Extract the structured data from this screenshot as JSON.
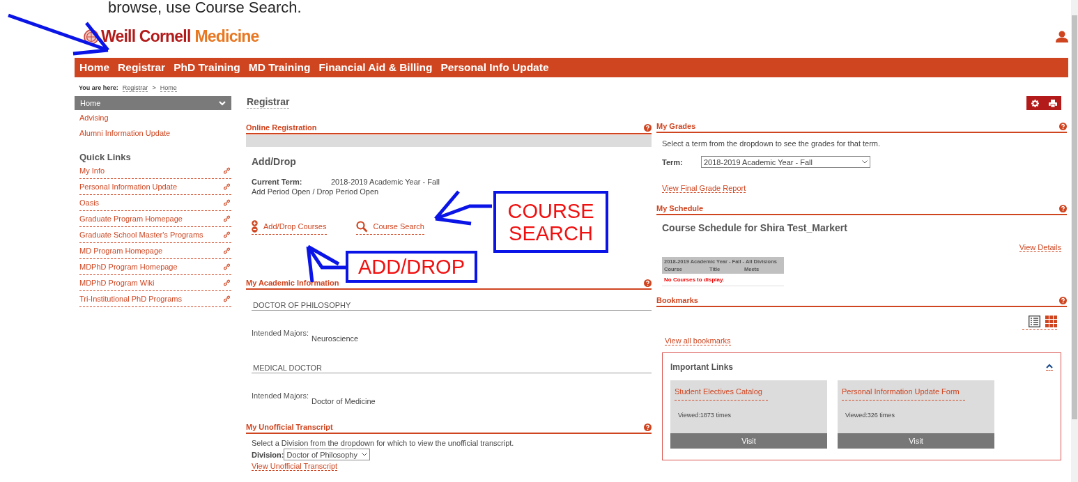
{
  "caption": "browse, use  Course Search.",
  "logo": {
    "primary": "Weill Cornell",
    "secondary": "Medicine"
  },
  "nav": [
    "Home",
    "Registrar",
    "PhD Training",
    "MD Training",
    "Financial Aid & Billing",
    "Personal Info Update"
  ],
  "breadcrumb": {
    "label": "You are here:",
    "items": [
      "Registrar",
      "Home"
    ],
    "separator": ">"
  },
  "sidebar": {
    "menu_title": "Home",
    "items": [
      "Advising",
      "Alumni Information Update"
    ],
    "quick_links_title": "Quick Links",
    "quick_links": [
      "My Info",
      "Personal Information Update",
      "Oasis",
      "Graduate Program Homepage",
      "Graduate School Master's Programs",
      "MD Program Homepage",
      "MDPhD Program Homepage",
      "MDPhD Program Wiki",
      "Tri-Institutional PhD Programs"
    ]
  },
  "page_title": "Registrar",
  "online_registration": {
    "title": "Online Registration",
    "heading": "Add/Drop",
    "term_label": "Current Term:",
    "term": "2018-2019 Academic Year - Fall",
    "status": "Add Period Open / Drop Period Open",
    "actions": [
      {
        "kind": "add_drop",
        "label": "Add/Drop Courses"
      },
      {
        "kind": "search",
        "label": "Course Search"
      }
    ]
  },
  "academic_info": {
    "title": "My Academic Information",
    "programs": [
      {
        "name": "DOCTOR OF PHILOSOPHY",
        "majors_label": "Intended Majors:",
        "majors": "Neuroscience"
      },
      {
        "name": "MEDICAL DOCTOR",
        "majors_label": "Intended Majors:",
        "majors": "Doctor of Medicine"
      }
    ]
  },
  "transcript": {
    "title": "My Unofficial Transcript",
    "instructions": "Select a Division from the dropdown for which to view the unofficial transcript.",
    "division_label": "Division:",
    "division": "Doctor of Philosophy",
    "link": "View Unofficial Transcript"
  },
  "grades": {
    "title": "My Grades",
    "instructions": "Select a term from the dropdown to see the grades for that term.",
    "term_label": "Term:",
    "term": "2018-2019 Academic Year - Fall",
    "link": "View Final Grade Report"
  },
  "schedule": {
    "title": "My Schedule",
    "heading": "Course Schedule for Shira Test_Markert",
    "details_link": "View Details",
    "table": {
      "caption": "2018-2019 Academic Year - Fall - All Divisions",
      "columns": [
        "Course",
        "Title",
        "Meets"
      ],
      "empty": "No Courses to display."
    }
  },
  "bookmarks": {
    "title": "Bookmarks",
    "all_link": "View all bookmarks",
    "important_links": {
      "title": "Important Links",
      "expanded": true,
      "links": [
        {
          "title": "Student Electives Catalog",
          "views": "Viewed:1873 times",
          "button": "Visit"
        },
        {
          "title": "Personal Information Update Form",
          "views": "Viewed:326 times",
          "button": "Visit"
        }
      ]
    }
  },
  "callouts": [
    {
      "text": "COURSE SEARCH"
    },
    {
      "text": "ADD/DROP"
    }
  ]
}
